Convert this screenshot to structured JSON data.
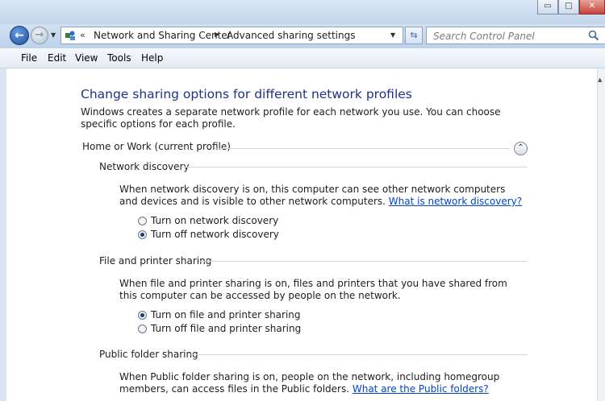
{
  "window": {
    "title": "",
    "minimize_label": "▭",
    "maximize_label": "□",
    "close_label": "✕"
  },
  "nav": {
    "address_chevron": "«",
    "breadcrumb": [
      "Network and Sharing Center",
      "Advanced sharing settings"
    ],
    "search_placeholder": "Search Control Panel"
  },
  "menu": [
    "File",
    "Edit",
    "View",
    "Tools",
    "Help"
  ],
  "page": {
    "heading": "Change sharing options for different network profiles",
    "intro": "Windows creates a separate network profile for each network you use. You can choose specific options for each profile.",
    "profile": "Home or Work (current profile)",
    "sections": [
      {
        "title": "Network discovery",
        "description": "When network discovery is on, this computer can see other network computers and devices and is visible to other network computers.",
        "link": "What is network discovery?",
        "options": [
          {
            "label": "Turn on network discovery",
            "checked": false
          },
          {
            "label": "Turn off network discovery",
            "checked": true
          }
        ]
      },
      {
        "title": "File and printer sharing",
        "description": "When file and printer sharing is on, files and printers that you have shared from this computer can be accessed by people on the network.",
        "link": "",
        "options": [
          {
            "label": "Turn on file and printer sharing",
            "checked": true
          },
          {
            "label": "Turn off file and printer sharing",
            "checked": false
          }
        ]
      },
      {
        "title": "Public folder sharing",
        "description": "When Public folder sharing is on, people on the network, including homegroup members, can access files in the Public folders.",
        "link": "What are the Public folders?",
        "options": []
      }
    ]
  },
  "colors": {
    "heading": "#1e3287",
    "link": "#0044cc"
  }
}
